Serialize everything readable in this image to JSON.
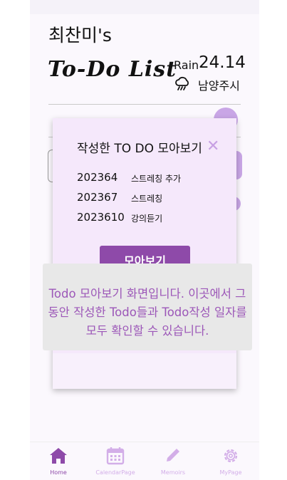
{
  "header": {
    "user_title": "최찬미's",
    "brand_title": "To-Do List",
    "weather_condition": "Rain",
    "weather_temp": "24.14",
    "weather_icon": "rain-cloud-icon",
    "weather_place": "남양주시"
  },
  "modal": {
    "title": "작성한 TO DO 모아보기",
    "close_icon": "close-icon",
    "items": [
      {
        "date": "202364",
        "text": "스트레칭 추가"
      },
      {
        "date": "202367",
        "text": "스트레칭"
      },
      {
        "date": "2023610",
        "text": "강의듣기"
      }
    ],
    "button_label": "모아보기"
  },
  "tooltip": {
    "text": "Todo 모아보기 화면입니다. 이곳에서 그동안 작성한 Todo들과 Todo작성 일자를 모두 확인할 수 있습니다."
  },
  "nav": {
    "items": [
      {
        "label": "Home",
        "icon": "home-icon",
        "active": true
      },
      {
        "label": "CalendarPage",
        "icon": "calendar-icon",
        "active": false
      },
      {
        "label": "Memoirs",
        "icon": "pencil-icon",
        "active": false
      },
      {
        "label": "MyPage",
        "icon": "gear-icon",
        "active": false
      }
    ]
  },
  "colors": {
    "accent": "#8e4aa9",
    "accent_light": "#c9a6e6",
    "modal_bg": "#f5e8fb",
    "tooltip_bg": "#e8e8e8",
    "tooltip_text": "#9c57b8"
  }
}
